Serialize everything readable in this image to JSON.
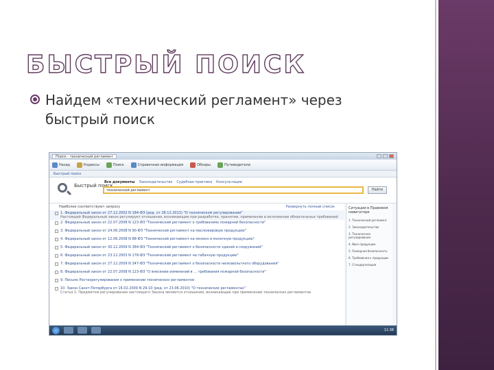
{
  "slide": {
    "title": "БЫСТРЫЙ ПОИСК",
    "bullet_line1": "Найдем «технический регламент» через",
    "bullet_line2": "быстрый поиск"
  },
  "colors": {
    "accent": "#6b3a68",
    "band": "#4e2a4d",
    "search_highlight": "#e9b640",
    "link": "#2d4f91"
  },
  "screenshot": {
    "window_tab": "Поиск - технический регламент",
    "toolbar": [
      {
        "label": "Назад",
        "icon": "back-icon"
      },
      {
        "label": "Кодексы",
        "icon": "book-icon"
      },
      {
        "label": "Поиск",
        "icon": "search-icon"
      },
      {
        "label": "Справочная информация",
        "icon": "info-icon"
      },
      {
        "label": "Обзоры",
        "icon": "news-icon"
      },
      {
        "label": "Путеводители",
        "icon": "compass-icon"
      }
    ],
    "search": {
      "label": "Быстрый поиск",
      "filter_tabs": [
        "Все документы",
        "Законодательство",
        "Судебная практика",
        "Консультации"
      ],
      "query": "технический регламент",
      "find_button": "Найти"
    },
    "results_header": "Наиболее соответствуют запросу",
    "expand_link": "Развернуть полный список",
    "results": [
      {
        "title": "1. Федеральный закон от 27.12.2002 N 184-ФЗ (ред. от 28.12.2013) \"О техническом регулировании\"",
        "snippet": "Настоящий Федеральный закон регулирует отношения, возникающие при разработке, принятии, применении и исполнении обязательных требований"
      },
      {
        "title": "2. Федеральный закон от 22.07.2008 N 123-ФЗ \"Технический регламент о требованиях пожарной безопасности\"",
        "snippet": ""
      },
      {
        "title": "3. Федеральный закон от 24.06.2008 N 90-ФЗ \"Технический регламент на масложировую продукцию\"",
        "snippet": ""
      },
      {
        "title": "4. Федеральный закон от 12.06.2008 N 88-ФЗ \"Технический регламент на молоко и молочную продукцию\"",
        "snippet": ""
      },
      {
        "title": "5. Федеральный закон от 30.12.2009 N 384-ФЗ \"Технический регламент о безопасности зданий и сооружений\"",
        "snippet": ""
      },
      {
        "title": "6. Федеральный закон от 23.12.2003 N 178-ФЗ \"Технический регламент на табачную продукцию\"",
        "snippet": ""
      },
      {
        "title": "7. Федеральный закон от 27.12.2009 N 347-ФЗ \"Технический регламент о безопасности низковольтного оборудования\"",
        "snippet": ""
      },
      {
        "title": "8. Федеральный закон от 22.07.2008 N 123-ФЗ \"О внесении изменений в ... требования пожарной безопасности\"",
        "snippet": ""
      },
      {
        "title": "9. Письмо Ростехрегулирования о применении технических регламентов",
        "snippet": ""
      },
      {
        "title": "10. Закон Санкт-Петербурга от 16.02.2009 N 29-10 (ред. от 23.06.2010) \"О технических регламентах\"",
        "snippet": "Статья 1. Предметом регулирования настоящего Закона являются отношения, возникающие при применении технических регламентов"
      }
    ],
    "right_panel": {
      "title": "Ситуации в Правовом навигаторе",
      "items": [
        "1. Технический регламент",
        "2. Законодательство",
        "3. Техническое регулирование",
        "4. Ввоз продукции",
        "5. Пожарная безопасность",
        "6. Требования к продукции",
        "7. Стандартизация"
      ]
    },
    "taskbar_clock": "11:38"
  }
}
